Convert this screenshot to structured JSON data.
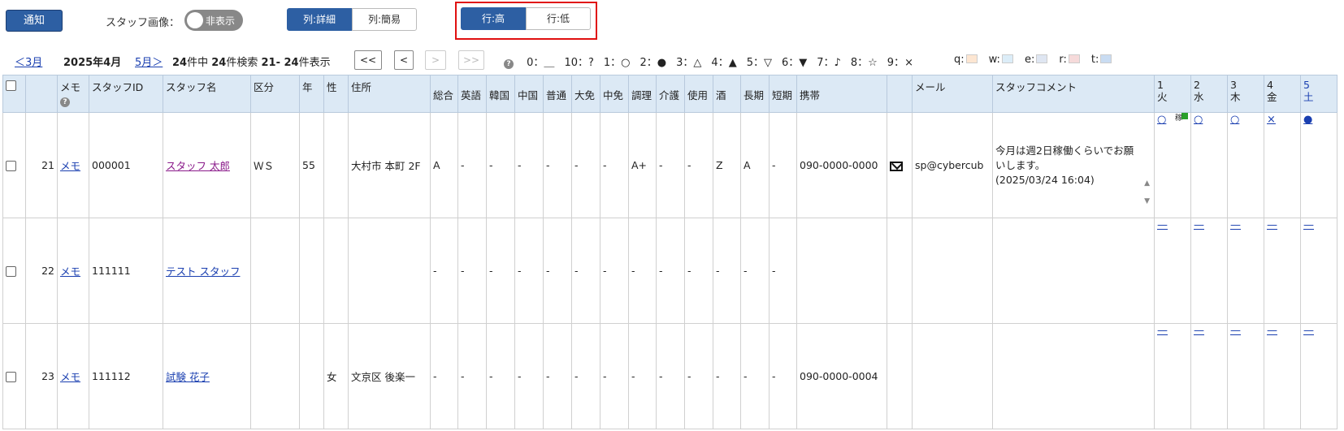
{
  "toolbar": {
    "notice_label": "通知",
    "staff_image_label": "スタッフ画像：",
    "staff_image_toggle": "非表示",
    "col_detail": "列:詳細",
    "col_simple": "列:簡易",
    "row_high": "行:高",
    "row_low": "行:低"
  },
  "nav": {
    "prev_month": "＜3月",
    "current_month": "2025年4月",
    "next_month": "5月＞",
    "count_a": "24",
    "count_a_suffix": "件中",
    "count_b": "24",
    "count_b_suffix": "件検索",
    "range": "21- 24",
    "range_suffix": "件表示",
    "first": "<<",
    "prev": "<",
    "next": ">",
    "last": ">>",
    "legend_help": "?",
    "legend": [
      {
        "key": "0：",
        "sym": "＿"
      },
      {
        "key": "10：",
        "sym": "?"
      },
      {
        "key": "1：",
        "sym": "○"
      },
      {
        "key": "2：",
        "sym": "●"
      },
      {
        "key": "3：",
        "sym": "△"
      },
      {
        "key": "4：",
        "sym": "▲"
      },
      {
        "key": "5：",
        "sym": "▽"
      },
      {
        "key": "6：",
        "sym": "▼"
      },
      {
        "key": "7：",
        "sym": "♪"
      },
      {
        "key": "8：",
        "sym": "☆"
      },
      {
        "key": "9：",
        "sym": "×"
      }
    ],
    "colors": [
      {
        "key": "q:",
        "color": "#fde6d2"
      },
      {
        "key": "w:",
        "color": "#dcedf8"
      },
      {
        "key": "e:",
        "color": "#dfe6f2"
      },
      {
        "key": "r:",
        "color": "#f6dada"
      },
      {
        "key": "t:",
        "color": "#c9dcf2"
      }
    ]
  },
  "table": {
    "headers": {
      "memo": "メモ",
      "staff_id": "スタッフID",
      "staff_name": "スタッフ名",
      "kubun": "区分",
      "age": "年",
      "sex": "性",
      "address": "住所",
      "sogo": "総合",
      "eigo": "英語",
      "kankoku": "韓国",
      "chugoku": "中国",
      "futsu": "普通",
      "daimen": "大免",
      "chumen": "中免",
      "chori": "調理",
      "kaigo": "介護",
      "shiyo": "使用",
      "sake": "酒",
      "choki": "長期",
      "tanki": "短期",
      "mobile": "携帯",
      "mail": "メール",
      "comment": "スタッフコメント",
      "days": [
        {
          "d": "1",
          "w": "火"
        },
        {
          "d": "2",
          "w": "水"
        },
        {
          "d": "3",
          "w": "木"
        },
        {
          "d": "4",
          "w": "金"
        },
        {
          "d": "5",
          "w": "土"
        }
      ]
    },
    "rows": [
      {
        "no": "21",
        "memo": "メモ",
        "id": "000001",
        "name": "スタッフ 太郎",
        "kubun": "ＷＳ",
        "age": "55",
        "sex": "",
        "address": "大村市 本町 2F",
        "sogo": "A",
        "eigo": "-",
        "kankoku": "-",
        "chugoku": "-",
        "futsu": "-",
        "daimen": "-",
        "chumen": "-",
        "chori": "A+",
        "kaigo": "-",
        "shiyo": "-",
        "sake": "Z",
        "choki": "A",
        "tanki": "-",
        "mobile": "090-0000-0000",
        "mail": "sp@cybercub",
        "comment": "今月は週2日稼働くらいでお願いします。",
        "comment_date": "(2025/03/24 16:04)",
        "note_mark": "稼",
        "days": [
          "○",
          "○",
          "○",
          "×",
          "●"
        ]
      },
      {
        "no": "22",
        "memo": "メモ",
        "id": "111111",
        "name": "テスト スタッフ",
        "kubun": "",
        "age": "",
        "sex": "",
        "address": "",
        "sogo": "-",
        "eigo": "-",
        "kankoku": "-",
        "chugoku": "-",
        "futsu": "-",
        "daimen": "-",
        "chumen": "-",
        "chori": "-",
        "kaigo": "-",
        "shiyo": "-",
        "sake": "-",
        "choki": "-",
        "tanki": "-",
        "mobile": "",
        "mail": "",
        "comment": "",
        "comment_date": "",
        "days": [
          "—",
          "—",
          "—",
          "—",
          "—"
        ]
      },
      {
        "no": "23",
        "memo": "メモ",
        "id": "111112",
        "name": "試験 花子",
        "kubun": "",
        "age": "",
        "sex": "女",
        "address": "文京区 後楽一",
        "sogo": "-",
        "eigo": "-",
        "kankoku": "-",
        "chugoku": "-",
        "futsu": "-",
        "daimen": "-",
        "chumen": "-",
        "chori": "-",
        "kaigo": "-",
        "shiyo": "-",
        "sake": "-",
        "choki": "-",
        "tanki": "-",
        "mobile": "090-0000-0004",
        "mail": "",
        "comment": "",
        "comment_date": "",
        "days": [
          "—",
          "—",
          "—",
          "—",
          "—"
        ]
      }
    ]
  }
}
